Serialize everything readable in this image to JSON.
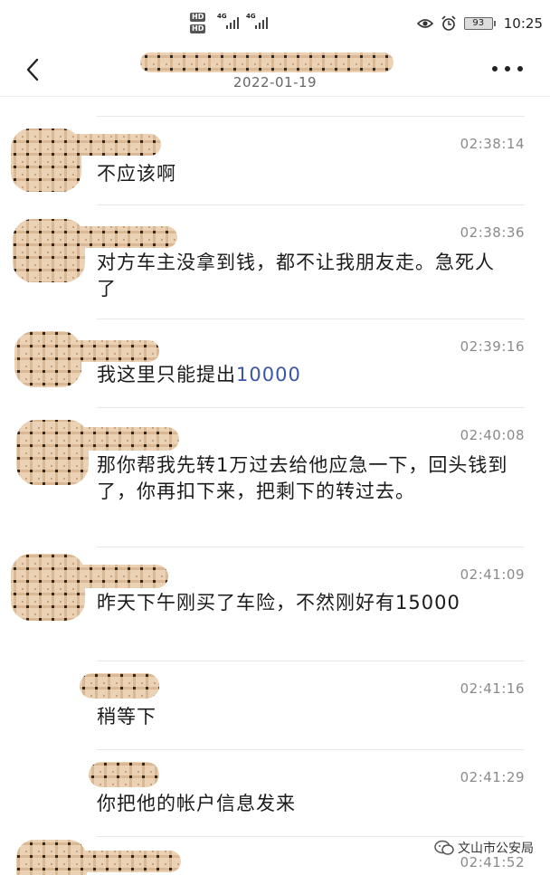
{
  "status_bar": {
    "hd1": "HD",
    "hd2": "HD",
    "net1": "4G",
    "net2": "4G",
    "battery": "93",
    "time": "10:25",
    "icons": [
      "eye-icon",
      "alarm-icon",
      "battery-icon"
    ]
  },
  "header": {
    "date": "2022-01-19",
    "icons": [
      "back-arrow-icon",
      "more-icon"
    ]
  },
  "messages": [
    {
      "time": "02:38:14",
      "text_a": "不应该啊",
      "text_num": "",
      "text_b": ""
    },
    {
      "time": "02:38:36",
      "text_a": "对方车主没拿到钱，都不让我朋友走。急死人了",
      "text_num": "",
      "text_b": ""
    },
    {
      "time": "02:39:16",
      "text_a": "我这里只能提出",
      "text_num": "10000",
      "text_b": ""
    },
    {
      "time": "02:40:08",
      "text_a": "那你帮我先转1万过去给他应急一下，回头钱到了，你再扣下来，把剩下的转过去。",
      "text_num": "",
      "text_b": ""
    },
    {
      "time": "02:41:09",
      "text_a": "昨天下午刚买了车险，不然刚好有15000",
      "text_num": "",
      "text_b": ""
    },
    {
      "time": "02:41:16",
      "text_a": "稍等下",
      "text_num": "",
      "text_b": ""
    },
    {
      "time": "02:41:29",
      "text_a": "你把他的帐户信息发来",
      "text_num": "",
      "text_b": ""
    },
    {
      "time": "02:41:52",
      "text_a": "",
      "text_num": "",
      "text_b": ""
    }
  ],
  "watermark": {
    "text": "文山市公安局",
    "icon": "wechat-official-account-icon"
  },
  "colors": {
    "background": "#ffffff",
    "time_text": "#8a8a8a",
    "divider": "#e8e8e8",
    "number_link": "#3a56a8",
    "mosaic_light": "#e8c9a8",
    "mosaic_dark": "#3a3028"
  }
}
